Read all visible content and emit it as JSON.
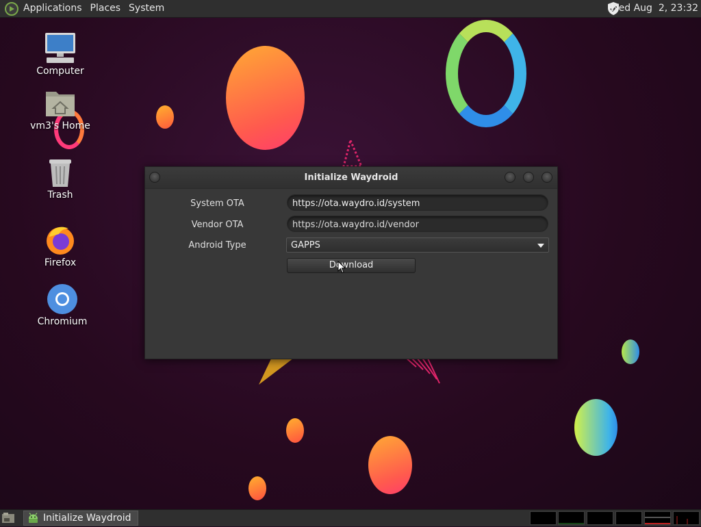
{
  "top_panel": {
    "menus": [
      "Applications",
      "Places",
      "System"
    ],
    "clock": "Wed Aug  2, 23:32",
    "icons": {
      "logo": "mate-logo-icon",
      "shield": "security-shield-icon"
    }
  },
  "desktop": {
    "icons": [
      {
        "label": "Computer",
        "icon": "computer-icon"
      },
      {
        "label": "vm3's Home",
        "icon": "home-folder-icon"
      },
      {
        "label": "Trash",
        "icon": "trash-icon"
      },
      {
        "label": "Firefox",
        "icon": "firefox-icon"
      },
      {
        "label": "Chromium",
        "icon": "chromium-icon"
      }
    ]
  },
  "dialog": {
    "title": "Initialize Waydroid",
    "system_ota_label": "System OTA",
    "system_ota_value": "https://ota.waydro.id/system",
    "vendor_ota_label": "Vendor OTA",
    "vendor_ota_value": "https://ota.waydro.id/vendor",
    "android_type_label": "Android Type",
    "android_type_value": "GAPPS",
    "download_label": "Download"
  },
  "taskbar": {
    "task_label": "Initialize Waydroid",
    "task_icon": "waydroid-icon",
    "show_desktop_icon": "show-desktop-icon"
  },
  "colors": {
    "desktop_bg": "#240c22",
    "panel": "#2f2f2f",
    "dialog_bg": "#383838",
    "entry_bg": "#2b2b2b"
  }
}
